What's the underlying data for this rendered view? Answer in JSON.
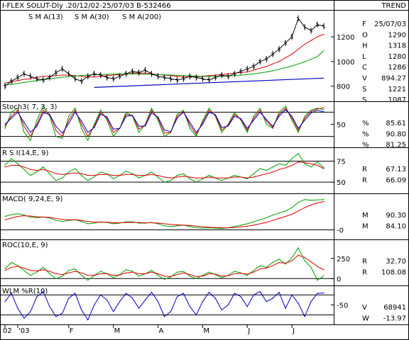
{
  "header": {
    "title": "I-FLEX SOLUT-Dly .20/12/02-25/07/03  B-532466",
    "trend": "TREND"
  },
  "colors": {
    "red": "#e00000",
    "green": "#00a000",
    "blue": "#0000c0",
    "close": "#000000"
  },
  "chart_data": [
    {
      "type": "line",
      "panel": "price",
      "legend": [
        {
          "label": "S M A(13)",
          "color": "red"
        },
        {
          "label": "S M A(30)",
          "color": "green"
        },
        {
          "label": "S M A(200)",
          "color": "blue"
        }
      ],
      "y_ticks": [
        "1200",
        "1000",
        "800"
      ],
      "ylim": [
        700,
        1390
      ],
      "series": [
        {
          "name": "S M A(13)",
          "color": "red",
          "values": [
            825,
            835,
            845,
            855,
            860,
            870,
            880,
            880,
            885,
            890,
            890,
            885,
            880,
            875,
            875,
            880,
            885,
            890,
            895,
            900,
            905,
            905,
            905,
            900,
            895,
            890,
            885,
            880,
            875,
            875,
            875,
            880,
            885,
            890,
            895,
            900,
            905,
            910,
            915,
            930,
            945,
            960,
            980,
            1000,
            1030,
            1060,
            1100,
            1140,
            1170,
            1200,
            1221
          ]
        },
        {
          "name": "S M A(30)",
          "color": "green",
          "values": [
            810,
            815,
            822,
            830,
            838,
            845,
            852,
            860,
            866,
            872,
            878,
            882,
            886,
            890,
            893,
            895,
            897,
            898,
            899,
            900,
            900,
            899,
            898,
            896,
            894,
            892,
            890,
            888,
            886,
            884,
            882,
            880,
            879,
            879,
            880,
            882,
            885,
            889,
            894,
            900,
            907,
            915,
            925,
            937,
            950,
            964,
            980,
            998,
            1018,
            1040,
            1087
          ]
        },
        {
          "name": "S M A(200)",
          "color": "blue",
          "values": [
            null,
            null,
            null,
            null,
            null,
            null,
            null,
            null,
            null,
            null,
            null,
            null,
            null,
            null,
            null,
            null,
            null,
            null,
            null,
            null,
            null,
            null,
            null,
            null,
            null,
            null,
            null,
            null,
            null,
            null,
            null,
            null,
            null,
            null,
            null,
            null,
            null,
            null,
            null,
            null,
            null,
            null,
            null,
            null,
            null,
            null,
            null,
            null,
            null,
            null,
            null
          ]
        },
        {
          "name": "Close",
          "color": "close",
          "values": [
            800,
            840,
            870,
            900,
            880,
            860,
            850,
            870,
            910,
            940,
            900,
            860,
            840,
            880,
            900,
            890,
            870,
            860,
            880,
            900,
            920,
            910,
            930,
            900,
            880,
            870,
            860,
            850,
            860,
            880,
            870,
            860,
            850,
            870,
            890,
            880,
            900,
            920,
            940,
            960,
            1000,
            1020,
            1060,
            1100,
            1150,
            1200,
            1350,
            1280,
            1250,
            1300,
            1286
          ]
        }
      ],
      "sma200_line": {
        "from_index": 14,
        "from": 790,
        "to": 865
      },
      "stats": [
        {
          "label": "F",
          "value": "25/07/03",
          "color": "close"
        },
        {
          "label": "O",
          "value": "1290",
          "color": "close"
        },
        {
          "label": "H",
          "value": "1318",
          "color": "close"
        },
        {
          "label": "L",
          "value": "1280",
          "color": "close"
        },
        {
          "label": "C",
          "value": "1286",
          "color": "close"
        },
        {
          "label": "V",
          "value": "894.27",
          "color": "close"
        },
        {
          "label": "S",
          "value": "1221",
          "color": "red"
        },
        {
          "label": "S",
          "value": "1087",
          "color": "green"
        }
      ]
    },
    {
      "type": "line",
      "panel": "stoch",
      "title": "Stoch3( 7, 3, 3)",
      "y_ticks": [
        "50"
      ],
      "ylim": [
        0,
        100
      ],
      "hlines": [
        20,
        80
      ],
      "series": [
        {
          "name": "%K",
          "color": "green",
          "values": [
            40,
            80,
            90,
            30,
            10,
            60,
            95,
            70,
            20,
            15,
            70,
            90,
            40,
            10,
            50,
            85,
            60,
            20,
            40,
            80,
            70,
            30,
            50,
            90,
            60,
            20,
            30,
            75,
            85,
            40,
            20,
            60,
            90,
            70,
            30,
            50,
            80,
            60,
            30,
            70,
            90,
            50,
            40,
            80,
            95,
            60,
            30,
            70,
            85,
            90,
            86
          ]
        },
        {
          "name": "%D",
          "color": "red",
          "values": [
            45,
            70,
            85,
            45,
            20,
            50,
            85,
            75,
            35,
            20,
            60,
            85,
            50,
            20,
            45,
            80,
            65,
            30,
            40,
            75,
            72,
            38,
            48,
            85,
            65,
            28,
            30,
            70,
            82,
            48,
            25,
            55,
            85,
            72,
            36,
            48,
            75,
            62,
            35,
            65,
            85,
            58,
            42,
            75,
            90,
            65,
            35,
            65,
            82,
            88,
            91
          ]
        },
        {
          "name": "%",
          "color": "blue",
          "values": [
            50,
            65,
            80,
            55,
            30,
            45,
            78,
            75,
            45,
            28,
            52,
            80,
            58,
            30,
            42,
            75,
            68,
            38,
            40,
            70,
            72,
            45,
            46,
            78,
            68,
            36,
            32,
            65,
            80,
            55,
            30,
            50,
            80,
            74,
            42,
            46,
            70,
            64,
            40,
            60,
            80,
            62,
            45,
            70,
            86,
            70,
            40,
            60,
            78,
            85,
            81
          ]
        }
      ],
      "stats": [
        {
          "label": "%",
          "value": "85.61",
          "color": "green"
        },
        {
          "label": "%",
          "value": "90.80",
          "color": "red"
        },
        {
          "label": "%",
          "value": "81.25",
          "color": "blue"
        }
      ]
    },
    {
      "type": "line",
      "panel": "rsi",
      "title": "R S I(14,E, 9)",
      "y_ticks": [
        "75",
        "50"
      ],
      "ylim": [
        40,
        88
      ],
      "hlines": [
        50,
        75
      ],
      "series": [
        {
          "name": "RSI",
          "color": "green",
          "values": [
            70,
            78,
            72,
            65,
            58,
            62,
            68,
            60,
            52,
            55,
            62,
            66,
            58,
            52,
            56,
            62,
            60,
            54,
            58,
            63,
            60,
            55,
            58,
            62,
            56,
            50,
            52,
            58,
            60,
            54,
            50,
            54,
            58,
            55,
            52,
            55,
            58,
            56,
            54,
            60,
            66,
            64,
            68,
            72,
            70,
            78,
            84,
            72,
            68,
            74,
            67
          ]
        },
        {
          "name": "Signal",
          "color": "red",
          "values": [
            68,
            70,
            70,
            68,
            65,
            64,
            65,
            63,
            60,
            59,
            60,
            61,
            60,
            58,
            58,
            59,
            59,
            58,
            58,
            59,
            59,
            58,
            58,
            59,
            58,
            56,
            55,
            56,
            57,
            56,
            55,
            55,
            56,
            55,
            55,
            55,
            56,
            56,
            55,
            56,
            58,
            60,
            62,
            65,
            67,
            70,
            74,
            73,
            72,
            70,
            66
          ]
        }
      ],
      "stats": [
        {
          "label": "R",
          "value": "67.13",
          "color": "green"
        },
        {
          "label": "R",
          "value": "66.09",
          "color": "red"
        }
      ]
    },
    {
      "type": "line",
      "panel": "macd",
      "title": "MACD( 9,24,E, 9)",
      "y_ticks": [
        "-0"
      ],
      "ylim": [
        -20,
        100
      ],
      "hlines": [
        0
      ],
      "series": [
        {
          "name": "MACD",
          "color": "green",
          "values": [
            40,
            45,
            48,
            44,
            38,
            36,
            38,
            35,
            28,
            25,
            28,
            30,
            25,
            18,
            20,
            24,
            22,
            18,
            20,
            24,
            24,
            20,
            20,
            22,
            18,
            12,
            10,
            12,
            14,
            10,
            6,
            5,
            6,
            5,
            4,
            6,
            10,
            14,
            18,
            24,
            30,
            36,
            44,
            50,
            56,
            66,
            82,
            90,
            88,
            89,
            90
          ]
        },
        {
          "name": "Signal",
          "color": "red",
          "values": [
            30,
            35,
            40,
            42,
            41,
            39,
            38,
            37,
            34,
            31,
            30,
            30,
            28,
            25,
            23,
            23,
            23,
            21,
            21,
            22,
            22,
            22,
            21,
            21,
            20,
            18,
            16,
            15,
            14,
            13,
            11,
            9,
            8,
            7,
            6,
            6,
            7,
            9,
            11,
            14,
            18,
            22,
            28,
            34,
            40,
            46,
            56,
            66,
            74,
            80,
            84
          ]
        }
      ],
      "stats": [
        {
          "label": "M",
          "value": "90.30",
          "color": "green"
        },
        {
          "label": "M",
          "value": "84.10",
          "color": "red"
        }
      ]
    },
    {
      "type": "line",
      "panel": "roc",
      "title": "ROC(10,E, 9)",
      "y_ticks": [
        "250",
        "0"
      ],
      "ylim": [
        -50,
        450
      ],
      "hlines": [
        0
      ],
      "series": [
        {
          "name": "ROC",
          "color": "green",
          "values": [
            120,
            200,
            160,
            100,
            40,
            80,
            140,
            60,
            0,
            30,
            100,
            120,
            40,
            -20,
            40,
            90,
            60,
            10,
            50,
            110,
            90,
            30,
            60,
            100,
            40,
            -10,
            20,
            80,
            90,
            30,
            0,
            40,
            80,
            50,
            10,
            40,
            90,
            70,
            40,
            100,
            160,
            140,
            200,
            240,
            180,
            260,
            380,
            220,
            140,
            -20,
            33
          ]
        },
        {
          "name": "Signal",
          "color": "red",
          "values": [
            100,
            140,
            150,
            130,
            100,
            95,
            110,
            90,
            60,
            50,
            70,
            90,
            70,
            40,
            40,
            60,
            60,
            40,
            45,
            70,
            80,
            60,
            60,
            80,
            60,
            30,
            25,
            50,
            70,
            50,
            25,
            30,
            60,
            55,
            30,
            35,
            60,
            65,
            55,
            80,
            120,
            130,
            160,
            200,
            190,
            220,
            290,
            260,
            210,
            150,
            108
          ]
        }
      ],
      "stats": [
        {
          "label": "R",
          "value": "32.70",
          "color": "green"
        },
        {
          "label": "R",
          "value": "108.08",
          "color": "red"
        }
      ]
    },
    {
      "type": "line",
      "panel": "wlm",
      "title": "WLM %R(10)",
      "y_ticks": [
        "-50"
      ],
      "ylim": [
        -100,
        0
      ],
      "hlines": [
        -20,
        -80
      ],
      "series": [
        {
          "name": "%R",
          "color": "blue",
          "values": [
            -40,
            -15,
            -60,
            -90,
            -70,
            -25,
            -10,
            -55,
            -85,
            -75,
            -30,
            -15,
            -65,
            -95,
            -50,
            -20,
            -35,
            -70,
            -40,
            -15,
            -30,
            -60,
            -35,
            -12,
            -40,
            -85,
            -70,
            -25,
            -15,
            -55,
            -80,
            -40,
            -12,
            -30,
            -65,
            -50,
            -15,
            -25,
            -55,
            -20,
            -10,
            -40,
            -30,
            -12,
            -60,
            -20,
            -45,
            -85,
            -40,
            -15,
            -14
          ]
        }
      ],
      "stats": [
        {
          "label": "V",
          "value": "68941",
          "color": "close"
        },
        {
          "label": "W",
          "value": "-13.97",
          "color": "close"
        }
      ]
    }
  ],
  "x_axis": {
    "ticks": [
      {
        "label": "02",
        "index": 0
      },
      {
        "label": "'03",
        "index": 2
      },
      {
        "label": "F",
        "index": 10
      },
      {
        "label": "M",
        "index": 17
      },
      {
        "label": "A",
        "index": 24
      },
      {
        "label": "M",
        "index": 31
      },
      {
        "label": "J",
        "index": 38
      },
      {
        "label": "J",
        "index": 45
      }
    ]
  }
}
